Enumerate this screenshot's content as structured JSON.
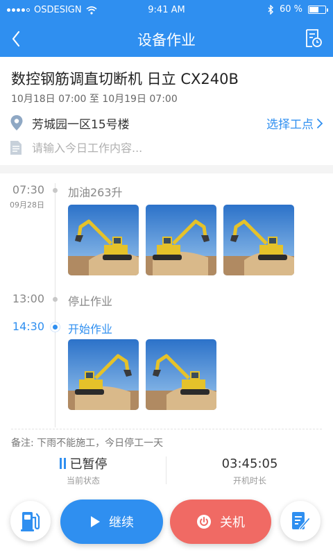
{
  "status_bar": {
    "carrier": "OSDESIGN",
    "time": "9:41 AM",
    "battery": "60 %",
    "battery_level": 0.6
  },
  "header": {
    "title": "设备作业"
  },
  "equipment": {
    "name": "数控钢筋调直切断机 日立 CX240B",
    "period": "10月18日 07:00 至 10月19日 07:00"
  },
  "location": {
    "name": "芳城园一区15号楼",
    "choose_label": "选择工点"
  },
  "work_note": {
    "placeholder": "请输入今日工作内容..."
  },
  "colors": {
    "primary": "#2f8ff0",
    "danger": "#f06a64",
    "muted": "#888888"
  },
  "timeline": [
    {
      "time": "07:30",
      "date": "09月28日",
      "label": "加油263升",
      "photos": 3
    },
    {
      "time": "13:00",
      "label": "停止作业",
      "photos": 0
    },
    {
      "time": "14:30",
      "label": "开始作业",
      "photos": 2,
      "active": true
    }
  ],
  "remark": "备注: 下雨不能施工，今日停工一天",
  "stats": {
    "state_value": "已暂停",
    "state_label": "当前状态",
    "duration_value": "03:45:05",
    "duration_label": "开机时长"
  },
  "actions": {
    "fuel_icon": "fuel-pump-icon",
    "continue_label": "继续",
    "shutdown_label": "关机",
    "edit_icon": "edit-log-icon"
  }
}
